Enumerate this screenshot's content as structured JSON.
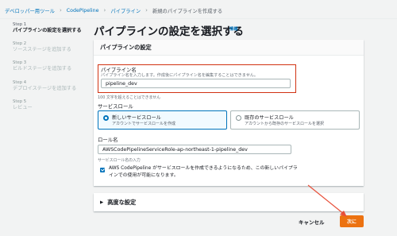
{
  "breadcrumb": {
    "items": [
      "デベロッパー用ツール",
      "CodePipeline",
      "パイプライン"
    ],
    "current": "新規のパイプラインを作成する"
  },
  "steps": [
    {
      "num": "Step 1",
      "title": "パイプラインの設定を選択する"
    },
    {
      "num": "Step 2",
      "title": "ソースステージを追加する"
    },
    {
      "num": "Step 3",
      "title": "ビルドステージを追加する"
    },
    {
      "num": "Step 4",
      "title": "デプロイステージを追加する"
    },
    {
      "num": "Step 5",
      "title": "レビュー"
    }
  ],
  "page": {
    "title": "パイプラインの設定を選択する",
    "info": "情報"
  },
  "settings": {
    "header": "パイプラインの設定",
    "pipeline_name": {
      "label": "パイプライン名",
      "desc": "パイプライン名を入力します。作成後にパイプライン名を編集することはできません。",
      "value": "pipeline_dev",
      "hint": "100 文字を超えることはできません"
    },
    "service_role": {
      "label": "サービスロール",
      "options": [
        {
          "title": "新しいサービスロール",
          "desc": "アカウントでサービスロールを作成",
          "selected": true
        },
        {
          "title": "既存のサービスロール",
          "desc": "アカウントから既存のサービスロールを選択",
          "selected": false
        }
      ]
    },
    "role_name": {
      "label": "ロール名",
      "value": "AWSCodePipelineServiceRole-ap-northeast-1-pipeline_dev",
      "hint": "サービスロール名の入力"
    },
    "checkbox": {
      "text": "AWS CodePipeline がサービスロールを作成できるようになるため、この新しいパイプラインでの使用が可能になります。",
      "checked": true
    }
  },
  "advanced": {
    "label": "高度な設定"
  },
  "footer": {
    "cancel": "キャンセル",
    "next": "次に"
  },
  "colors": {
    "link": "#0073bb",
    "primary_button": "#ec7211",
    "highlight": "#d13212",
    "annotation_arrow": "#e8503a"
  }
}
